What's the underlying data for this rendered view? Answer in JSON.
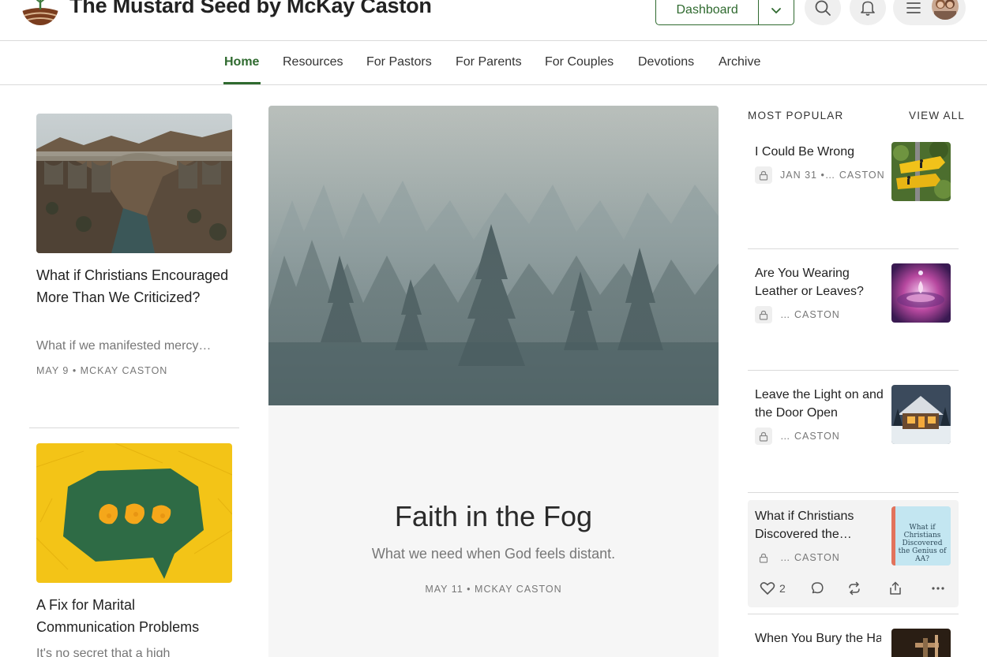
{
  "header": {
    "site_title": "The Mustard Seed by McKay Caston",
    "dashboard_label": "Dashboard"
  },
  "nav": {
    "items": [
      {
        "label": "Home",
        "active": true
      },
      {
        "label": "Resources"
      },
      {
        "label": "For Pastors"
      },
      {
        "label": "For Parents"
      },
      {
        "label": "For Couples"
      },
      {
        "label": "Devotions"
      },
      {
        "label": "Archive"
      }
    ]
  },
  "left_posts": [
    {
      "title": "What if Christians Encouraged More Than We Criticized?",
      "subtitle": "What if we manifested mercy…",
      "meta": "MAY 9 • MCKAY CASTON"
    },
    {
      "title": "A Fix for Marital Communication Problems",
      "subtitle": "It's no secret that a high"
    }
  ],
  "hero": {
    "title": "Faith in the Fog",
    "subtitle": "What we need when God feels distant.",
    "meta": "MAY 11 • MCKAY CASTON"
  },
  "popular": {
    "heading": "MOST POPULAR",
    "view_all": "VIEW ALL",
    "items": [
      {
        "title": "I Could Be Wrong",
        "meta": "JAN 31 •… CASTON"
      },
      {
        "title": "Are You Wearing Leather or Leaves?",
        "meta": "… CASTON"
      },
      {
        "title": "Leave the Light on and the Door Open",
        "meta": "… CASTON"
      },
      {
        "title": "What if Christians Discovered the…",
        "meta": "… CASTON",
        "thumb_text": "What if Christians Discovered the Genius of AA?"
      },
      {
        "title": "When You Bury the Hatchet, Don't Lea"
      }
    ],
    "like_count": "2"
  },
  "colors": {
    "brand_green": "#2f6a2f",
    "text_muted": "#777777"
  },
  "icons": [
    "search-icon",
    "bell-icon",
    "hamburger-icon",
    "chevron-down-icon",
    "lock-icon",
    "heart-icon",
    "comment-icon",
    "restack-icon",
    "share-icon",
    "more-icon"
  ]
}
